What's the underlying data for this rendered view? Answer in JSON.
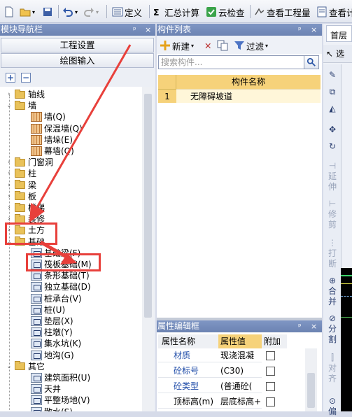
{
  "toolbar": {
    "define": "定义",
    "summary": "汇总计算",
    "cloud_check": "云检查",
    "view_qty": "查看工程量",
    "view_more": "查看计"
  },
  "left_panel": {
    "title": "模块导航栏",
    "pin": "ᵖ",
    "close": "×",
    "project_settings": "工程设置",
    "drawing_input": "绘图输入",
    "tree": [
      {
        "label": "轴线",
        "kind": "folder",
        "expand": "›"
      },
      {
        "label": "墙",
        "kind": "folder",
        "expand": "⌄"
      },
      {
        "label": "墙(Q)",
        "kind": "leaf"
      },
      {
        "label": "保温墙(Q)",
        "kind": "leaf"
      },
      {
        "label": "墙垛(E)",
        "kind": "leaf"
      },
      {
        "label": "幕墙(Q)",
        "kind": "leaf"
      },
      {
        "label": "门窗洞",
        "kind": "folder",
        "expand": "›"
      },
      {
        "label": "柱",
        "kind": "folder",
        "expand": "›"
      },
      {
        "label": "梁",
        "kind": "folder",
        "expand": "›"
      },
      {
        "label": "板",
        "kind": "folder",
        "expand": "›"
      },
      {
        "label": "楼梯",
        "kind": "folder",
        "expand": "›"
      },
      {
        "label": "装修",
        "kind": "folder",
        "expand": "›"
      },
      {
        "label": "土方",
        "kind": "folder",
        "expand": "›"
      },
      {
        "label": "基础",
        "kind": "folder",
        "expand": "⌄"
      },
      {
        "label": "基础梁(F)",
        "kind": "leaf"
      },
      {
        "label": "筏板基础(M)",
        "kind": "leaf"
      },
      {
        "label": "条形基础(T)",
        "kind": "leaf"
      },
      {
        "label": "独立基础(D)",
        "kind": "leaf"
      },
      {
        "label": "桩承台(V)",
        "kind": "leaf"
      },
      {
        "label": "桩(U)",
        "kind": "leaf"
      },
      {
        "label": "垫层(X)",
        "kind": "leaf"
      },
      {
        "label": "柱墩(Y)",
        "kind": "leaf"
      },
      {
        "label": "集水坑(K)",
        "kind": "leaf"
      },
      {
        "label": "地沟(G)",
        "kind": "leaf"
      },
      {
        "label": "其它",
        "kind": "folder",
        "expand": "⌄"
      },
      {
        "label": "建筑面积(U)",
        "kind": "leaf"
      },
      {
        "label": "天井",
        "kind": "leaf"
      },
      {
        "label": "平整场地(V)",
        "kind": "leaf"
      },
      {
        "label": "散水(S)",
        "kind": "leaf"
      }
    ]
  },
  "component_list": {
    "title": "构件列表",
    "new_label": "新建",
    "filter_label": "过滤",
    "search_placeholder": "搜索构件...",
    "col_name": "构件名称",
    "rows": [
      {
        "index": "1",
        "name": "无障碍坡道"
      }
    ]
  },
  "property_editor": {
    "title": "属性编辑框",
    "col_name": "属性名称",
    "col_value": "属性值",
    "col_extra": "附加",
    "rows": [
      {
        "name": "材质",
        "value": "现浇混凝"
      },
      {
        "name": "砼标号",
        "value": "(C30)"
      },
      {
        "name": "砼类型",
        "value": "(普通砼("
      },
      {
        "name": "顶标高(m)",
        "value": "层底标高+"
      }
    ]
  },
  "right_panel": {
    "tab_home": "首层",
    "select_label": "选",
    "tools": [
      "延伸",
      "修剪",
      "打断",
      "合并",
      "分割",
      "对齐",
      "偏"
    ]
  },
  "colors": {
    "accent": "#e8403b",
    "header": "#7188b8",
    "highlight": "#ffd66b"
  }
}
